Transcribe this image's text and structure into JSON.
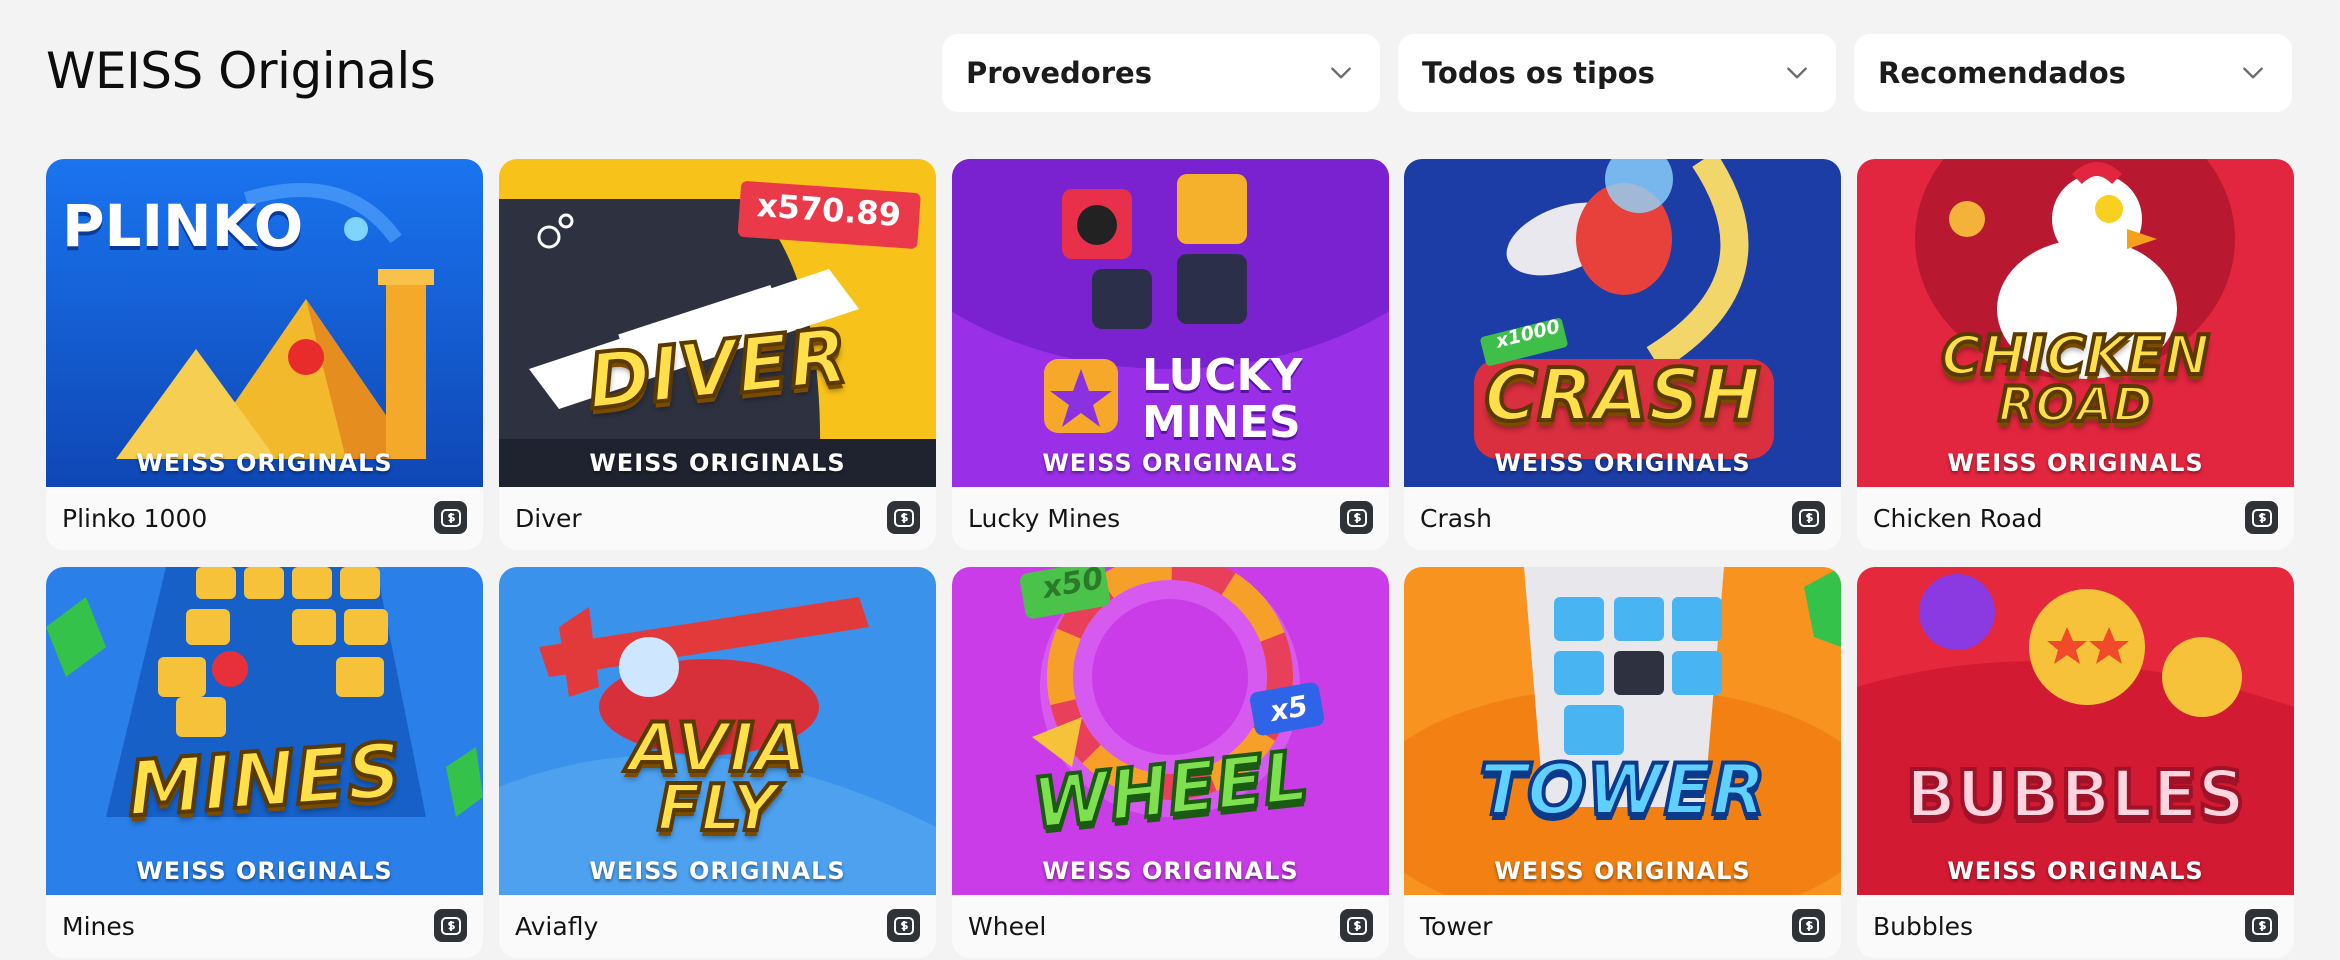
{
  "header": {
    "title": "WEISS Originals",
    "filters": [
      {
        "label": "Provedores"
      },
      {
        "label": "Todos os tipos"
      },
      {
        "label": "Recomendados"
      }
    ]
  },
  "games": [
    {
      "name": "Plinko 1000",
      "art_title": "PLINKO",
      "brand": "WEISS ORIGINALS",
      "bg": "#1f6fe0"
    },
    {
      "name": "Diver",
      "art_title": "DIVER",
      "multiplier": "x570.89",
      "brand": "WEISS ORIGINALS",
      "bg": "#f7c21a"
    },
    {
      "name": "Lucky Mines",
      "art_title_1": "LUCKY",
      "art_title_2": "MINES",
      "brand": "WEISS ORIGINALS",
      "bg": "#8b2be6"
    },
    {
      "name": "Crash",
      "art_title": "CRASH",
      "multiplier": "x1000",
      "brand": "WEISS ORIGINALS",
      "bg": "#1d3fa8"
    },
    {
      "name": "Chicken Road",
      "art_title_1": "CHICKEN",
      "art_title_2": "ROAD",
      "brand": "WEISS ORIGINALS",
      "bg": "#e3263f"
    },
    {
      "name": "Mines",
      "art_title": "MINES",
      "brand": "WEISS ORIGINALS",
      "bg": "#2a7fe8"
    },
    {
      "name": "Aviafly",
      "art_title_1": "AVIA",
      "art_title_2": "FLY",
      "brand": "WEISS ORIGINALS",
      "bg": "#3a8fe8"
    },
    {
      "name": "Wheel",
      "art_title": "WHEEL",
      "badge_1": "x50",
      "badge_2": "x5",
      "brand": "WEISS ORIGINALS",
      "bg": "#c63ae8"
    },
    {
      "name": "Tower",
      "art_title": "TOWER",
      "brand": "WEISS ORIGINALS",
      "bg": "#f7931e"
    },
    {
      "name": "Bubbles",
      "art_title": "BUBBLES",
      "brand": "WEISS ORIGINALS",
      "bg": "#e6283d"
    }
  ],
  "icons": {
    "filter_chevron": "chevron-down-icon",
    "game_badge": "currency-icon"
  }
}
